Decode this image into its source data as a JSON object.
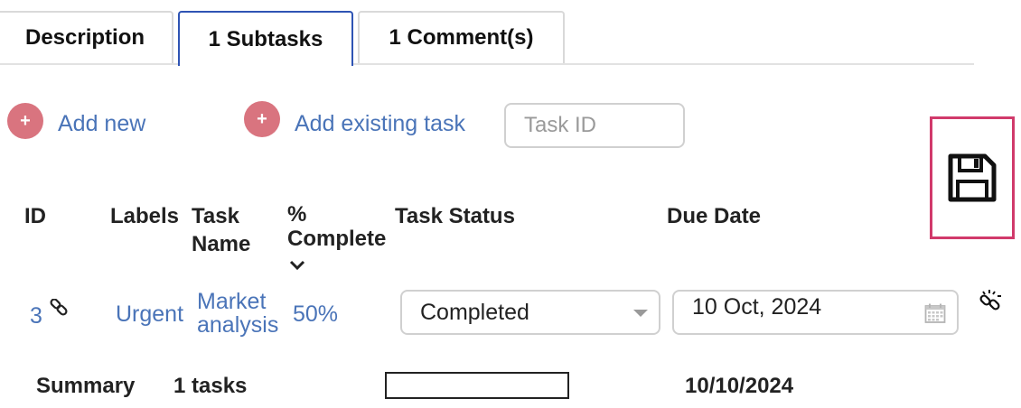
{
  "tabs": [
    {
      "label": "Description",
      "active": false
    },
    {
      "label": "1 Subtasks",
      "active": true
    },
    {
      "label": "1 Comment(s)",
      "active": false
    }
  ],
  "actions": {
    "add_new": "Add new",
    "add_existing": "Add existing task",
    "task_id_placeholder": "Task ID",
    "plus_symbol": "+"
  },
  "table": {
    "headers": {
      "id": "ID",
      "labels": "Labels",
      "task_name_line1": "Task",
      "task_name_line2": "Name",
      "percent_line1": "%",
      "percent_line2": "Complete",
      "task_status": "Task Status",
      "due_date": "Due Date"
    },
    "rows": [
      {
        "id": "3",
        "label": "Urgent",
        "task_name_line1": "Market",
        "task_name_line2": "analysis",
        "percent": "50%",
        "status": "Completed",
        "due_date": "10 Oct, 2024"
      }
    ]
  },
  "summary": {
    "label": "Summary",
    "tasks": "1 tasks",
    "progress": 0,
    "due_date": "10/10/2024"
  },
  "colors": {
    "accent_tab": "#2f54b4",
    "link": "#4a74b8",
    "plus_circle": "#d9747f",
    "save_highlight": "#d13a6b"
  },
  "icons": {
    "save": "floppy-disk-icon",
    "link": "link-icon",
    "unlink": "unlink-icon",
    "calendar": "calendar-icon",
    "sort": "chevron-down-icon"
  }
}
